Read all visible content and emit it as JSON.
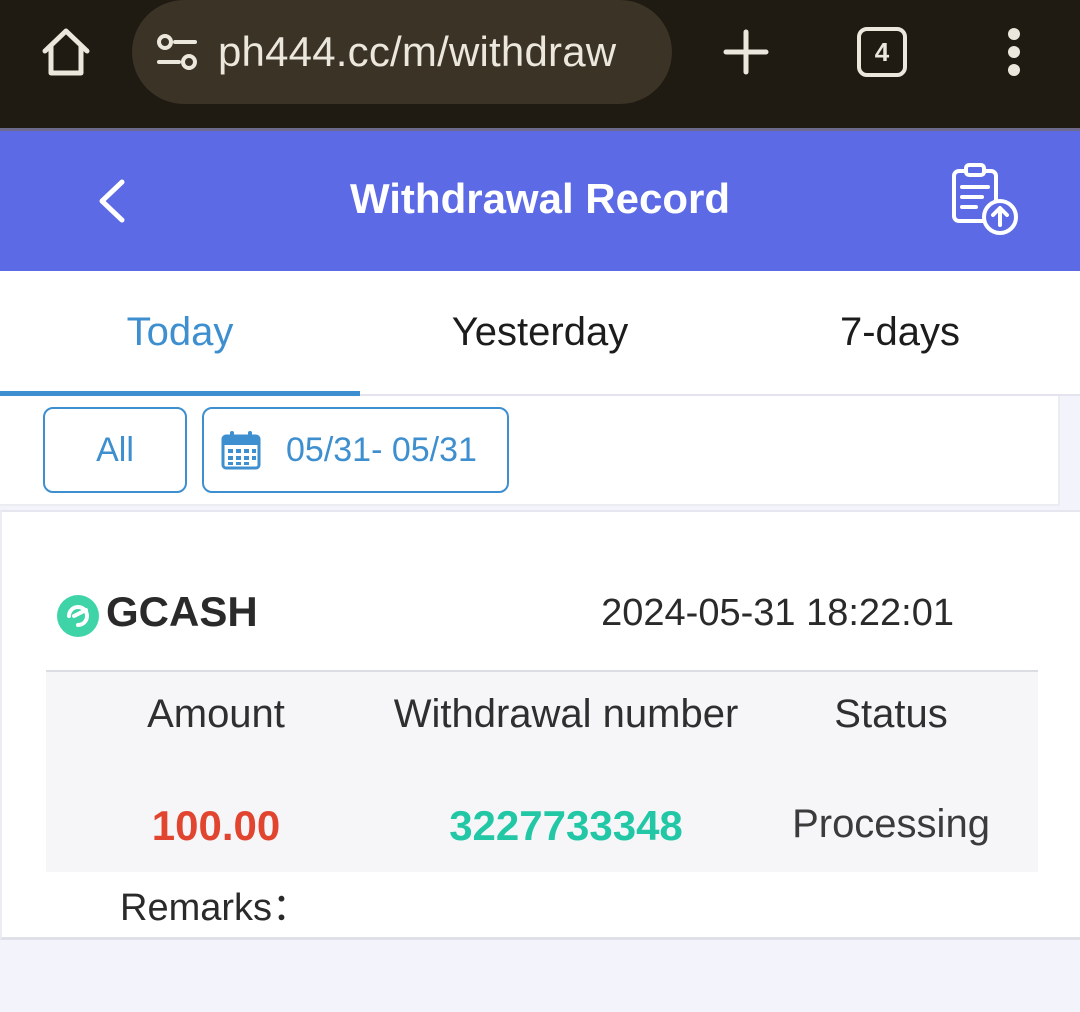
{
  "browser": {
    "url": "ph444.cc/m/withdraw",
    "tab_count": "4",
    "icons": [
      "home-icon",
      "site-settings-icon",
      "plus-icon",
      "tabs-icon",
      "more-vert-icon"
    ]
  },
  "header": {
    "title": "Withdrawal Record",
    "back_icon": "chevron-left-icon",
    "export_icon": "clipboard-upload-icon",
    "background_color": "#5c6ae6"
  },
  "tabs": [
    {
      "label": "Today",
      "active": true
    },
    {
      "label": "Yesterday",
      "active": false
    },
    {
      "label": "7-days",
      "active": false
    }
  ],
  "filters": {
    "type_label": "All",
    "date_range": "05/31- 05/31",
    "date_icon": "calendar-icon"
  },
  "record": {
    "method": "GCASH",
    "method_icon": "gcash-icon",
    "datetime": "2024-05-31 18:22:01",
    "columns": {
      "amount": "Amount",
      "number": "Withdrawal number",
      "status": "Status"
    },
    "amount": "100.00",
    "withdrawal_number": "3227733348",
    "status": "Processing",
    "remarks_label": "Remarks："
  },
  "colors": {
    "accent": "#3d8fcf",
    "amount": "#e2452f",
    "number": "#22c7a5"
  }
}
